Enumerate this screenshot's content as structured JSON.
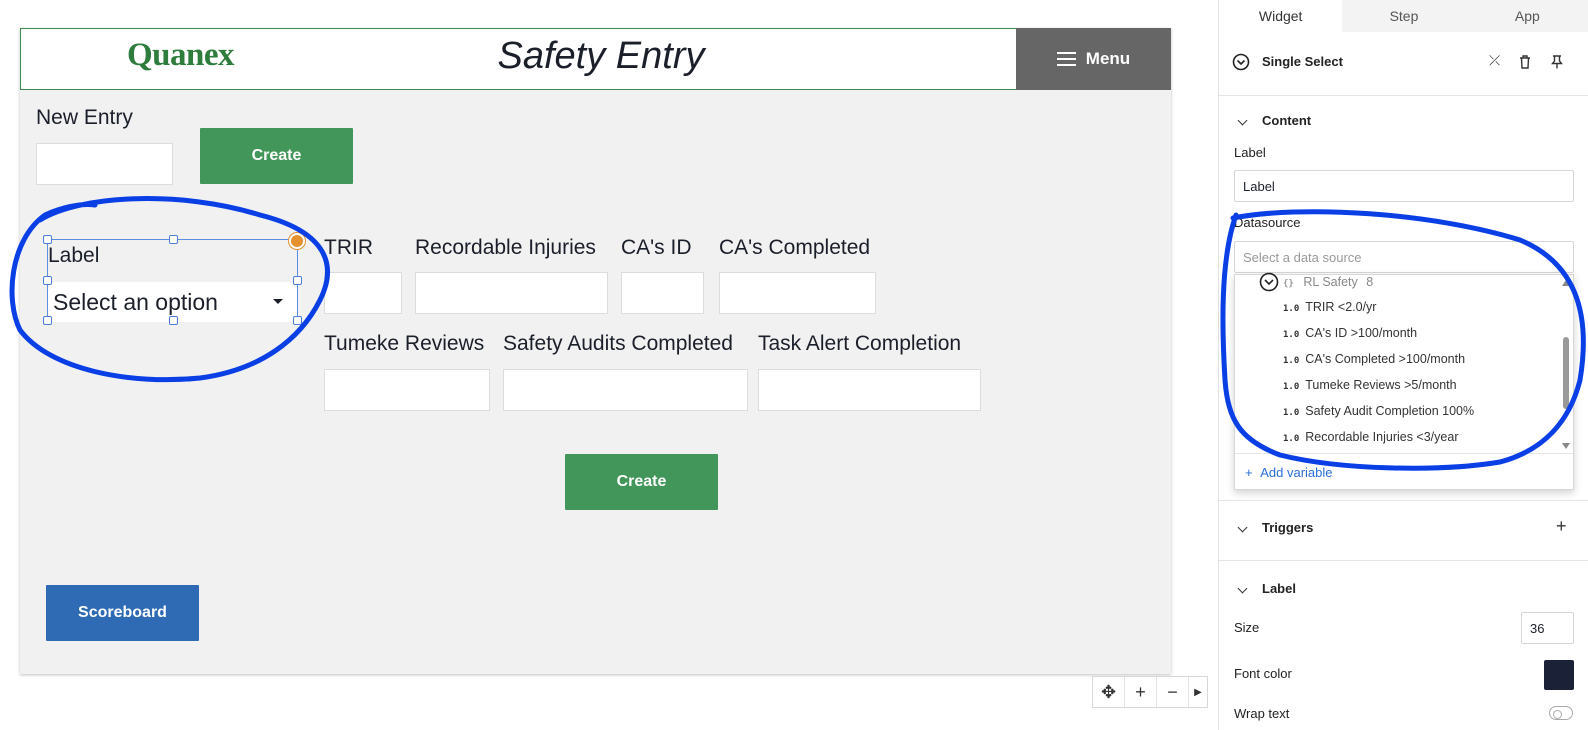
{
  "app": {
    "logo": "Quanex",
    "title": "Safety Entry",
    "menu_label": "Menu"
  },
  "form": {
    "new_entry_label": "New Entry",
    "create_top_label": "Create",
    "select_widget": {
      "label": "Label",
      "placeholder": "Select an option"
    },
    "fields": [
      {
        "label": "TRIR"
      },
      {
        "label": "Recordable Injuries"
      },
      {
        "label": "CA's ID"
      },
      {
        "label": "CA's Completed"
      },
      {
        "label": "Tumeke Reviews"
      },
      {
        "label": "Safety Audits Completed"
      },
      {
        "label": "Task Alert Completion"
      }
    ],
    "create_bottom_label": "Create",
    "scoreboard_label": "Scoreboard"
  },
  "toolbar": {
    "icons": [
      "move-icon",
      "zoom-in-icon",
      "zoom-out-icon",
      "chevron-right-icon"
    ],
    "zoom_in": "+",
    "zoom_out": "−"
  },
  "panel": {
    "tabs": [
      "Widget",
      "Step",
      "App"
    ],
    "active_tab": "Widget",
    "widget_type": "Single Select",
    "content_heading": "Content",
    "label_field_label": "Label",
    "label_field_value": "Label",
    "datasource_label": "Datasource",
    "datasource_placeholder": "Select a data source",
    "dropdown": {
      "group": {
        "type": "{}",
        "name": "RL Safety",
        "count": "8"
      },
      "items": [
        {
          "type": "1.0",
          "name": "TRIR <2.0/yr"
        },
        {
          "type": "1.0",
          "name": "CA's ID >100/month"
        },
        {
          "type": "1.0",
          "name": "CA's Completed >100/month"
        },
        {
          "type": "1.0",
          "name": "Tumeke Reviews >5/month"
        },
        {
          "type": "1.0",
          "name": "Safety Audit Completion 100%"
        },
        {
          "type": "1.0",
          "name": "Recordable Injuries <3/year"
        }
      ],
      "add_variable": "Add variable"
    },
    "triggers_heading": "Triggers",
    "label_heading": "Label",
    "size_label": "Size",
    "size_value": "36",
    "font_color_label": "Font color",
    "font_color_value": "#1b2238",
    "wrap_text_label": "Wrap text"
  },
  "colors": {
    "brand_green": "#2f7d3d",
    "button_green": "#43965a",
    "button_blue": "#2e6bb4",
    "menu_gray": "#666666",
    "annotation_blue": "#0a3fe6"
  }
}
